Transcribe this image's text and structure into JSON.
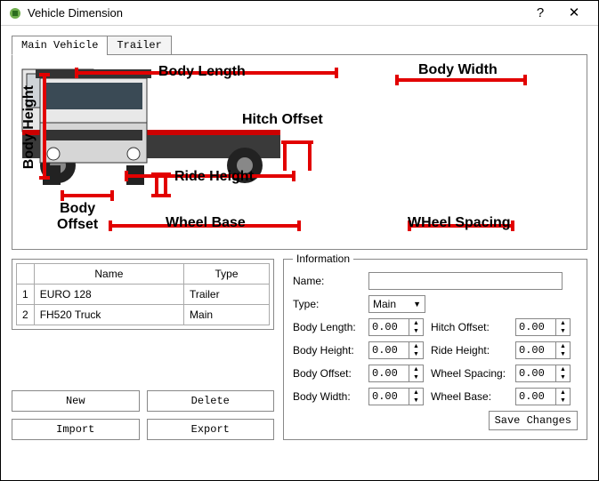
{
  "window": {
    "title": "Vehicle Dimension",
    "help": "?",
    "close": "✕"
  },
  "tabs": {
    "main": "Main Vehicle",
    "trailer": "Trailer"
  },
  "diagram": {
    "body_length": "Body Length",
    "body_height": "Body Height",
    "hitch_offset": "Hitch Offset",
    "ride_height": "Ride Height",
    "body_offset": "Body\nOffset",
    "wheel_base": "Wheel Base",
    "body_width": "Body Width",
    "wheel_spacing": "WHeel Spacing"
  },
  "grid": {
    "h_name": "Name",
    "h_type": "Type",
    "rows": [
      {
        "idx": "1",
        "name": "EURO 128",
        "type": "Trailer"
      },
      {
        "idx": "2",
        "name": "FH520 Truck",
        "type": "Main"
      }
    ]
  },
  "buttons": {
    "new": "New",
    "delete": "Delete",
    "import": "Import",
    "export": "Export",
    "save": "Save Changes"
  },
  "info": {
    "legend": "Information",
    "name_l": "Name:",
    "type_l": "Type:",
    "type_v": "Main",
    "body_length_l": "Body Length:",
    "body_height_l": "Body Height:",
    "body_offset_l": "Body Offset:",
    "body_width_l": "Body Width:",
    "hitch_offset_l": "Hitch Offset:",
    "ride_height_l": "Ride Height:",
    "wheel_spacing_l": "Wheel Spacing:",
    "wheel_base_l": "Wheel Base:",
    "name_v": "",
    "v": "0.00"
  }
}
